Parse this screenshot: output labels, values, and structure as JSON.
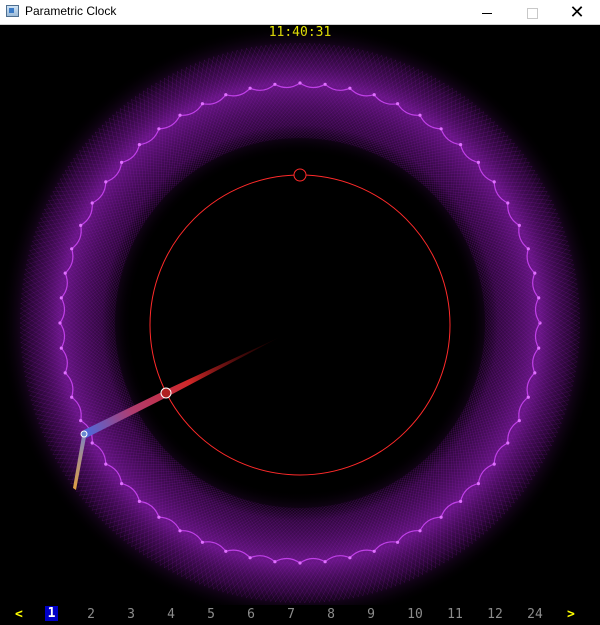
{
  "window": {
    "title": "Parametric Clock",
    "minimize_icon": "minimize-icon",
    "maximize_icon": "maximize-icon",
    "close_icon": "close-icon"
  },
  "clock": {
    "time": "11:40:31"
  },
  "bottom_bar": {
    "prev_label": "<",
    "next_label": ">",
    "options": [
      "1",
      "2",
      "3",
      "4",
      "5",
      "6",
      "7",
      "8",
      "9",
      "10",
      "11",
      "12",
      "24"
    ],
    "selected": "1"
  },
  "colors": {
    "time_text": "#ffff00",
    "pattern": "#a020c8",
    "circle": "#ff2a2a",
    "selected_option_bg": "#0000c8",
    "option_text": "#8c8c8c"
  }
}
